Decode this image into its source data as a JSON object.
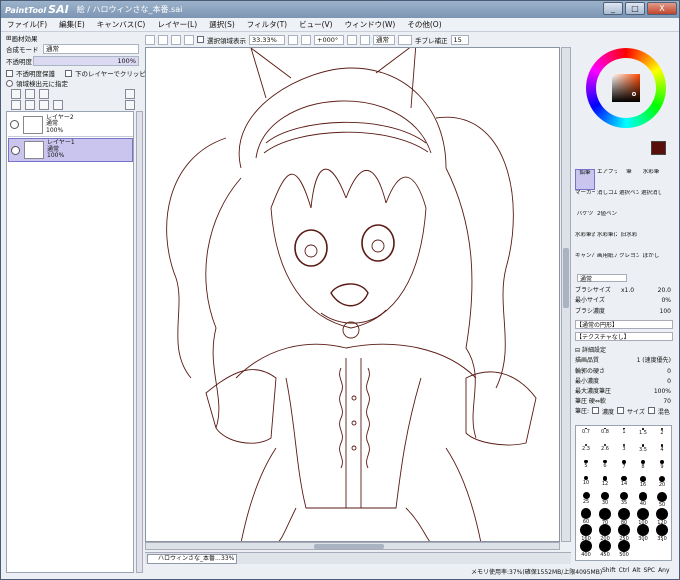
{
  "app": {
    "logo_small": "PaintTool",
    "logo_big": "SAI",
    "title": "絵 / ハロウィンさな_本番.sai"
  },
  "window_buttons": {
    "minimize": "_",
    "maximize": "□",
    "close": "X"
  },
  "menu": [
    "ファイル(F)",
    "編集(E)",
    "キャンバス(C)",
    "レイヤー(L)",
    "選択(S)",
    "フィルタ(T)",
    "ビュー(V)",
    "ウィンドウ(W)",
    "その他(O)"
  ],
  "left_panel": {
    "section_label": "画材効果",
    "blend_label": "合成モード",
    "blend_value": "通常",
    "opacity_label": "不透明度",
    "opacity_value": "100%",
    "checks": [
      "不透明度保護",
      "下のレイヤーでクリッピング",
      "領域検出元に指定"
    ],
    "layers": [
      {
        "name": "レイヤー2",
        "mode": "通常",
        "opacity": "100%"
      },
      {
        "name": "レイヤー1",
        "mode": "通常",
        "opacity": "100%"
      }
    ]
  },
  "canvas_toolbar": {
    "select_label": "選択領域表示",
    "zoom": "33.33%",
    "angle": "+000°",
    "mode": "通常",
    "stabilizer_label": "手ブレ補正",
    "stabilizer_value": "15"
  },
  "document_tab": {
    "name": "ハロウィンさな_本番...",
    "zoom": "33%"
  },
  "right_panel": {
    "tools": [
      [
        "鉛筆",
        "エアブラシ",
        "筆",
        "水彩筆"
      ],
      [
        "マーカー",
        "消しゴム",
        "選択ペン",
        "選択消し"
      ],
      [
        "バケツ",
        "2値ペン",
        "",
        ""
      ],
      [
        "水彩筆消し",
        "水彩筆(2)",
        "旧水彩",
        ""
      ],
      [
        "キャンバスアクリル",
        "画用紙アクリル",
        "クレヨン",
        "ぼかし"
      ]
    ],
    "brush_mode": "通常",
    "brush_size_label": "ブラシサイズ",
    "brush_size_mult": "x1.0",
    "brush_size_value": "20.0",
    "min_size_label": "最小サイズ",
    "min_size_value": "0%",
    "density_label": "ブラシ濃度",
    "density_value": "100",
    "shape_label": "【通常の円形】",
    "texture_label": "【テクスチャなし】",
    "detail_label": "詳細設定",
    "quality_label": "描画品質",
    "quality_value": "1 (速度優先)",
    "edge_label": "輪郭の硬さ",
    "edge_value": "0",
    "min_density_label": "最小濃度",
    "min_density_value": "0",
    "max_pressure_label": "最大濃度筆圧",
    "max_pressure_value": "100%",
    "pressure_label": "筆圧 硬⇔軟",
    "pressure_value": "70",
    "pressure_opts": [
      "濃度",
      "サイズ",
      "混色"
    ],
    "dot_sizes": [
      "0.7",
      "0.8",
      "1",
      "1.5",
      "2",
      "2.3",
      "2.6",
      "3",
      "3.5",
      "4",
      "5",
      "6",
      "7",
      "8",
      "9",
      "10",
      "12",
      "14",
      "16",
      "20",
      "25",
      "30",
      "35",
      "40",
      "50",
      "60",
      "70",
      "80",
      "100",
      "120",
      "160",
      "200",
      "250",
      "300",
      "350",
      "400",
      "450",
      "500",
      "",
      ""
    ]
  },
  "status": {
    "memory": "メモリ使用率:37%(確保1552MB/上限4095MB)",
    "keys": [
      "Shift",
      "Ctrl",
      "Alt",
      "SPC",
      "Any"
    ]
  },
  "colors": {
    "main_swatch": "#5a0f0a",
    "accent": "#c9c5ee"
  }
}
